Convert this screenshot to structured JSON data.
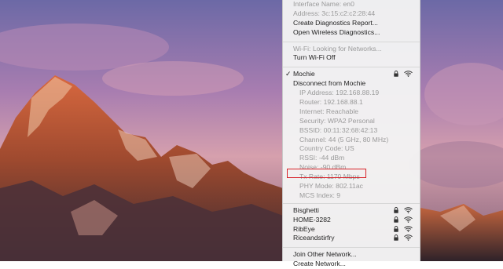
{
  "wifi_menu": {
    "interface_name": "Interface Name: en0",
    "address": "Address: 3c:15:c2:c2:28:44",
    "create_diagnostics_report": "Create Diagnostics Report...",
    "open_wireless_diagnostics": "Open Wireless Diagnostics...",
    "wifi_status": "Wi-Fi: Looking for Networks...",
    "turn_wifi_off": "Turn Wi-Fi Off",
    "connected_network": {
      "check_mark": "✓",
      "name": "Mochie",
      "disconnect": "Disconnect from Mochie",
      "details": [
        "IP Address: 192.168.88.19",
        "Router: 192.168.88.1",
        "Internet: Reachable",
        "Security: WPA2 Personal",
        "BSSID: 00:11:32:68:42:13",
        "Channel: 44 (5 GHz, 80 MHz)",
        "Country Code: US",
        "RSSI: -44 dBm",
        "Noise: -90 dBm",
        "Tx Rate: 1170 Mbps",
        "PHY Mode: 802.11ac",
        "MCS Index: 9"
      ]
    },
    "other_networks": [
      "Bisghetti",
      "HOME-3282",
      "RibEye",
      "Riceandstirfry"
    ],
    "join_other_network": "Join Other Network...",
    "create_network": "Create Network..."
  },
  "colors": {
    "highlight_border": "#d8232a",
    "menu_background": "#f3f3f3"
  },
  "icons": [
    "lock-icon",
    "wifi-icon",
    "checkmark-icon"
  ]
}
